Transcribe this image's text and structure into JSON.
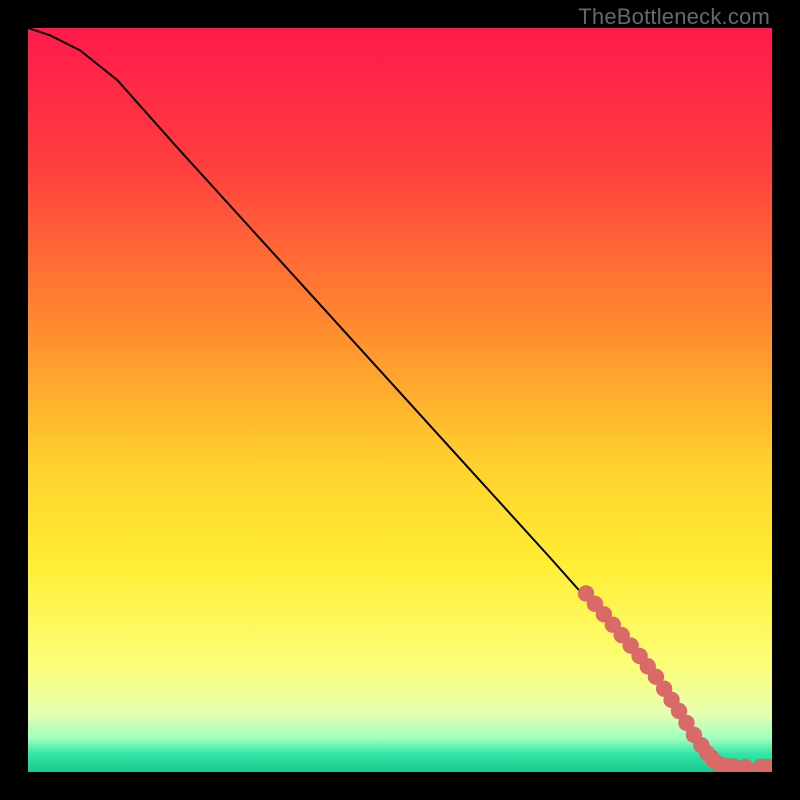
{
  "watermark": "TheBottleneck.com",
  "chart_data": {
    "type": "line",
    "title": "",
    "xlabel": "",
    "ylabel": "",
    "xlim": [
      0,
      100
    ],
    "ylim": [
      0,
      100
    ],
    "grid": false,
    "legend": false,
    "gradient_stops": [
      {
        "offset": 0.0,
        "color": "#ff1a4b"
      },
      {
        "offset": 0.18,
        "color": "#ff3d3f"
      },
      {
        "offset": 0.4,
        "color": "#ff8a2f"
      },
      {
        "offset": 0.58,
        "color": "#ffcf2e"
      },
      {
        "offset": 0.72,
        "color": "#ffee33"
      },
      {
        "offset": 0.86,
        "color": "#fcff7a"
      },
      {
        "offset": 0.92,
        "color": "#e7ffb0"
      },
      {
        "offset": 0.955,
        "color": "#9effc0"
      },
      {
        "offset": 0.975,
        "color": "#34e7a6"
      },
      {
        "offset": 1.0,
        "color": "#18c98f"
      }
    ],
    "series": [
      {
        "name": "bottleneck-curve",
        "color": "#000000",
        "x": [
          0,
          3,
          7,
          12,
          20,
          30,
          40,
          50,
          60,
          70,
          78,
          82,
          85,
          87,
          90,
          93,
          95,
          97,
          99,
          100
        ],
        "y": [
          100,
          99,
          97,
          93,
          84,
          73,
          62,
          51,
          40,
          29,
          20,
          16,
          12,
          9,
          5,
          2,
          1,
          0.8,
          0.7,
          0.7
        ]
      }
    ],
    "markers": {
      "name": "highlighted-points",
      "color": "#d96a68",
      "radius_frac": 0.011,
      "points": [
        {
          "x": 75.0,
          "y": 24.0
        },
        {
          "x": 76.2,
          "y": 22.6
        },
        {
          "x": 77.4,
          "y": 21.2
        },
        {
          "x": 78.6,
          "y": 19.8
        },
        {
          "x": 79.8,
          "y": 18.4
        },
        {
          "x": 81.0,
          "y": 17.0
        },
        {
          "x": 82.2,
          "y": 15.6
        },
        {
          "x": 83.3,
          "y": 14.2
        },
        {
          "x": 84.4,
          "y": 12.8
        },
        {
          "x": 85.5,
          "y": 11.2
        },
        {
          "x": 86.5,
          "y": 9.7
        },
        {
          "x": 87.5,
          "y": 8.2
        },
        {
          "x": 88.5,
          "y": 6.6
        },
        {
          "x": 89.5,
          "y": 5.0
        },
        {
          "x": 90.5,
          "y": 3.6
        },
        {
          "x": 91.3,
          "y": 2.5
        },
        {
          "x": 92.1,
          "y": 1.6
        },
        {
          "x": 93.0,
          "y": 1.0
        },
        {
          "x": 93.9,
          "y": 0.8
        },
        {
          "x": 94.8,
          "y": 0.75
        },
        {
          "x": 96.4,
          "y": 0.7
        },
        {
          "x": 98.5,
          "y": 0.7
        },
        {
          "x": 99.3,
          "y": 0.7
        }
      ]
    }
  }
}
